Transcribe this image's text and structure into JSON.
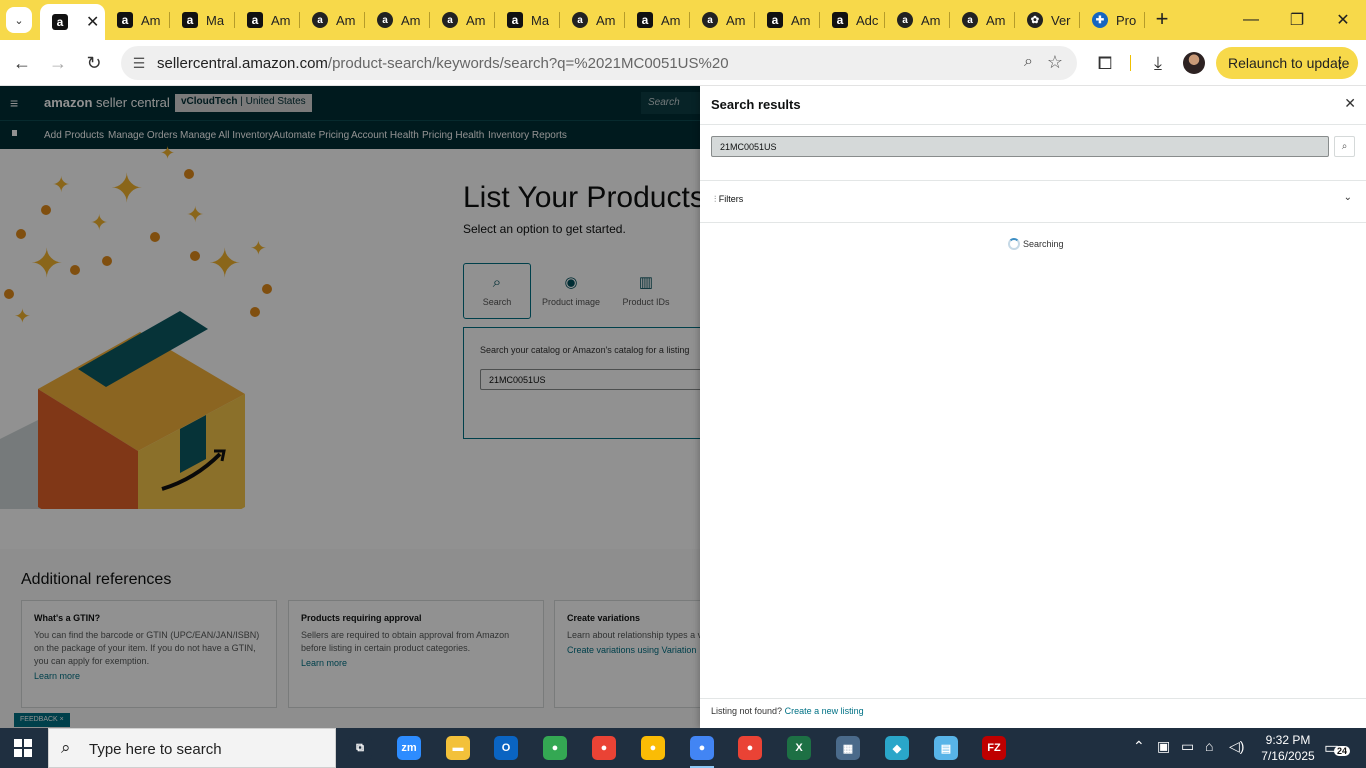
{
  "browser": {
    "tabs": [
      {
        "label": "",
        "favicon": "amazon-a",
        "active": true
      },
      {
        "label": "Am",
        "favicon": "amazon-a"
      },
      {
        "label": "Ma",
        "favicon": "amazon-a"
      },
      {
        "label": "Am",
        "favicon": "amazon-a"
      },
      {
        "label": "Am",
        "favicon": "amazon-smile"
      },
      {
        "label": "Am",
        "favicon": "amazon-smile"
      },
      {
        "label": "Am",
        "favicon": "amazon-smile"
      },
      {
        "label": "Ma",
        "favicon": "amazon-a"
      },
      {
        "label": "Am",
        "favicon": "amazon-smile"
      },
      {
        "label": "Am",
        "favicon": "amazon-a"
      },
      {
        "label": "Am",
        "favicon": "amazon-smile"
      },
      {
        "label": "Am",
        "favicon": "amazon-a"
      },
      {
        "label": "Adc",
        "favicon": "amazon-a"
      },
      {
        "label": "Am",
        "favicon": "amazon-smile"
      },
      {
        "label": "Am",
        "favicon": "amazon-smile"
      },
      {
        "label": "Ver",
        "favicon": "openai-icon"
      },
      {
        "label": "Pro",
        "favicon": "globe-icon"
      }
    ],
    "url_host": "sellercentral.amazon.com",
    "url_path": "/product-search/keywords/search?q=%2021MC0051US%20",
    "relaunch_label": "Relaunch to update",
    "accent_color": "#f7d94a"
  },
  "header": {
    "logo_text_1": "amazon",
    "logo_text_2": " seller central",
    "account_name": "vCloudTech",
    "account_region": "United States",
    "search_placeholder": "Search"
  },
  "nav": {
    "items": [
      "Add Products",
      "Manage Orders",
      "Manage All Inventory",
      "Automate Pricing",
      "Account Health",
      "Pricing Health",
      "Inventory Reports"
    ]
  },
  "hero": {
    "title": "List Your Products",
    "subtitle": "Select an option to get started.",
    "options": [
      {
        "label": "Search",
        "icon": "search-icon"
      },
      {
        "label": "Product image",
        "icon": "camera-icon"
      },
      {
        "label": "Product IDs",
        "icon": "barcode-icon"
      }
    ],
    "catalog_label": "Search your catalog or Amazon's catalog for a listing",
    "catalog_value": "21MC0051US"
  },
  "references": {
    "title": "Additional references",
    "cards": [
      {
        "title": "What's a GTIN?",
        "body": "You can find the barcode or GTIN (UPC/EAN/JAN/ISBN) on the package of your item. If you do not have a GTIN, you can apply for exemption.",
        "link": "Learn more"
      },
      {
        "title": "Products requiring approval",
        "body": "Sellers are required to obtain approval from Amazon before listing in certain product categories.",
        "link": "Learn more"
      },
      {
        "title": "Create variations",
        "body": "Learn about relationship types a variation relationships.",
        "link": "Create variations using Variation"
      }
    ],
    "feedback_label": "FEEDBACK"
  },
  "drawer": {
    "title": "Search results",
    "query": "21MC0051US",
    "filters_label": "Filters",
    "status": "Searching",
    "not_found_text": "Listing not found?",
    "create_link": "Create a new listing"
  },
  "taskbar": {
    "search_placeholder": "Type here to search",
    "time": "9:32 PM",
    "date": "7/16/2025",
    "notification_count": "24",
    "apps": [
      {
        "name": "task-view-icon",
        "glyph": "⧉",
        "color": "#1f2f40"
      },
      {
        "name": "zoom-icon",
        "glyph": "zm",
        "color": "#2d8cff"
      },
      {
        "name": "file-explorer-icon",
        "glyph": "▬",
        "color": "#f3c13a"
      },
      {
        "name": "outlook-icon",
        "glyph": "O",
        "color": "#0a64c2"
      },
      {
        "name": "chrome-icon",
        "glyph": "●",
        "color": "#34a853"
      },
      {
        "name": "chrome-icon",
        "glyph": "●",
        "color": "#ea4335"
      },
      {
        "name": "chrome-icon",
        "glyph": "●",
        "color": "#fbbc05"
      },
      {
        "name": "chrome-icon",
        "glyph": "●",
        "color": "#4285f4"
      },
      {
        "name": "chrome-icon",
        "glyph": "●",
        "color": "#ea4335"
      },
      {
        "name": "excel-icon",
        "glyph": "X",
        "color": "#1d7044"
      },
      {
        "name": "calculator-icon",
        "glyph": "▦",
        "color": "#4a6a8a"
      },
      {
        "name": "app-diamond-icon",
        "glyph": "◆",
        "color": "#2aa6c9"
      },
      {
        "name": "notepad-icon",
        "glyph": "▤",
        "color": "#58b4e8"
      },
      {
        "name": "filezilla-icon",
        "glyph": "FZ",
        "color": "#bf0000"
      }
    ]
  }
}
